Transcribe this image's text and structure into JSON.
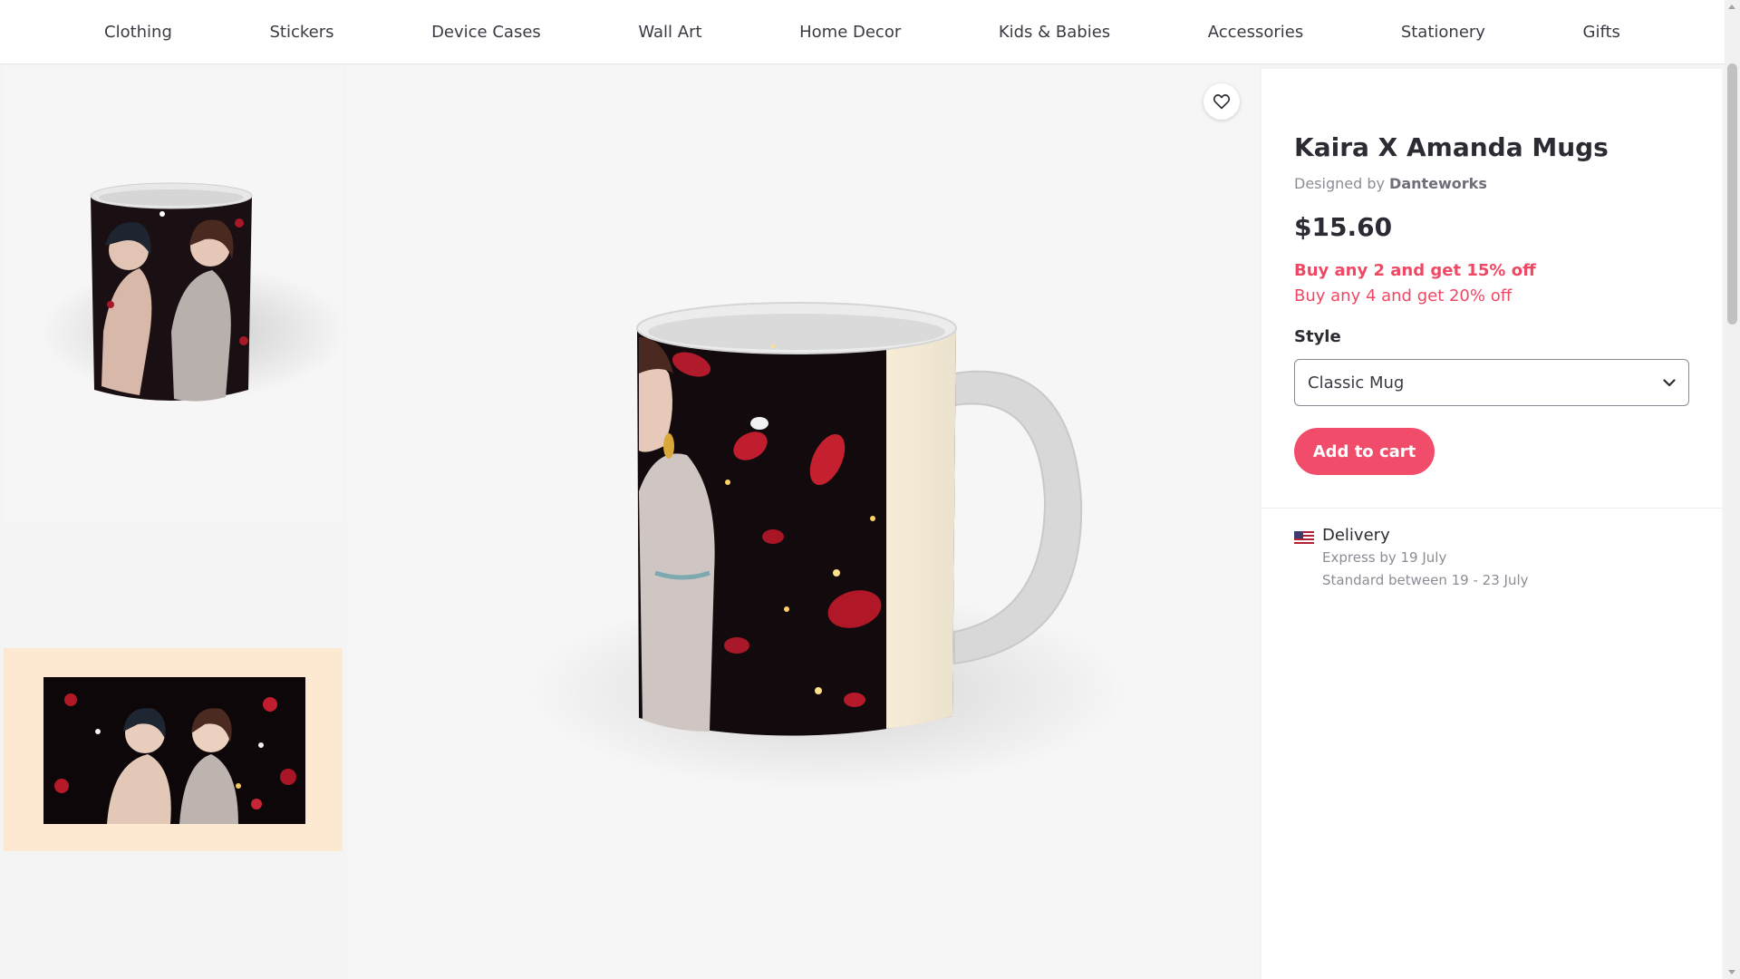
{
  "nav": {
    "items": [
      "Clothing",
      "Stickers",
      "Device Cases",
      "Wall Art",
      "Home Decor",
      "Kids & Babies",
      "Accessories",
      "Stationery",
      "Gifts"
    ]
  },
  "product": {
    "title": "Kaira X Amanda Mugs",
    "designed_by_prefix": "Designed by",
    "designer": "Danteworks",
    "price": "$15.60",
    "promo_1": "Buy any 2 and get 15% off",
    "promo_2": "Buy any 4 and get 20% off",
    "style_label": "Style",
    "style_selected": "Classic Mug",
    "add_to_cart": "Add to cart"
  },
  "delivery": {
    "title": "Delivery",
    "express": "Express by 19 July",
    "standard": "Standard between 19 - 23 July"
  },
  "icons": {
    "favorite": "heart-icon",
    "select_arrow": "chevron-down-icon",
    "flag": "us-flag-icon"
  },
  "colors": {
    "accent": "#f14d6b",
    "promo": "#ef4864",
    "thumb_highlight": "#fde9d2"
  }
}
